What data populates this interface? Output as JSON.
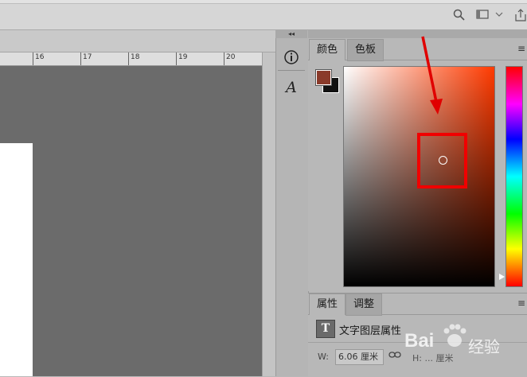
{
  "ruler": {
    "labels": [
      "16",
      "17",
      "18",
      "19",
      "20"
    ]
  },
  "dock": {
    "collapse_glyph": "◂◂",
    "info_icon": "info-icon",
    "char_icon": "character-icon",
    "char_glyph": "A"
  },
  "color_panel": {
    "tabs": [
      {
        "label": "颜色"
      },
      {
        "label": "色板"
      }
    ],
    "menu_glyph": "≡",
    "foreground_color": "#8a3a2a",
    "background_color": "#111111",
    "field_hue_color": "#ff3a00",
    "highlight_color": "#f00000"
  },
  "properties_panel": {
    "tabs": [
      {
        "label": "属性"
      },
      {
        "label": "调整"
      }
    ],
    "menu_glyph": "≡",
    "type_glyph": "T",
    "title": "文字图层属性",
    "w_label": "W:",
    "w_value": "6.06 厘米",
    "h_value_partial": "H: ... 厘米"
  },
  "watermark": {
    "text": "Bai",
    "sub": "经验"
  }
}
